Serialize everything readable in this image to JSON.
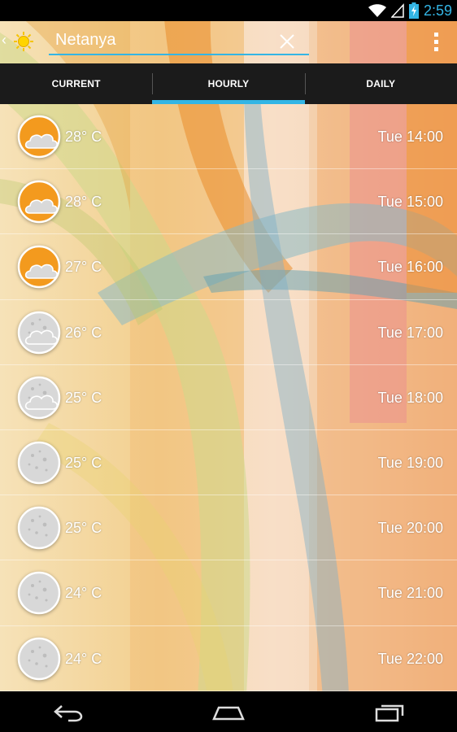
{
  "status_bar": {
    "time": "2:59"
  },
  "action_bar": {
    "city": "Netanya"
  },
  "tabs": [
    {
      "label": "CURRENT",
      "active": false
    },
    {
      "label": "HOURLY",
      "active": true
    },
    {
      "label": "DAILY",
      "active": false
    }
  ],
  "hourly": [
    {
      "icon": "sun-cloud-icon",
      "temp": "28° C",
      "time": "Tue 14:00"
    },
    {
      "icon": "sun-cloud-icon",
      "temp": "28° C",
      "time": "Tue 15:00"
    },
    {
      "icon": "sun-cloud-icon",
      "temp": "27° C",
      "time": "Tue 16:00"
    },
    {
      "icon": "moon-cloud-icon",
      "temp": "26° C",
      "time": "Tue 17:00"
    },
    {
      "icon": "moon-cloud-icon",
      "temp": "25° C",
      "time": "Tue 18:00"
    },
    {
      "icon": "moon-icon",
      "temp": "25° C",
      "time": "Tue 19:00"
    },
    {
      "icon": "moon-icon",
      "temp": "25° C",
      "time": "Tue 20:00"
    },
    {
      "icon": "moon-icon",
      "temp": "24° C",
      "time": "Tue 21:00"
    },
    {
      "icon": "moon-icon",
      "temp": "24° C",
      "time": "Tue 22:00"
    }
  ],
  "colors": {
    "accent": "#33b5e5",
    "sun": "#f39a1e",
    "moon": "#d8d8d8"
  }
}
